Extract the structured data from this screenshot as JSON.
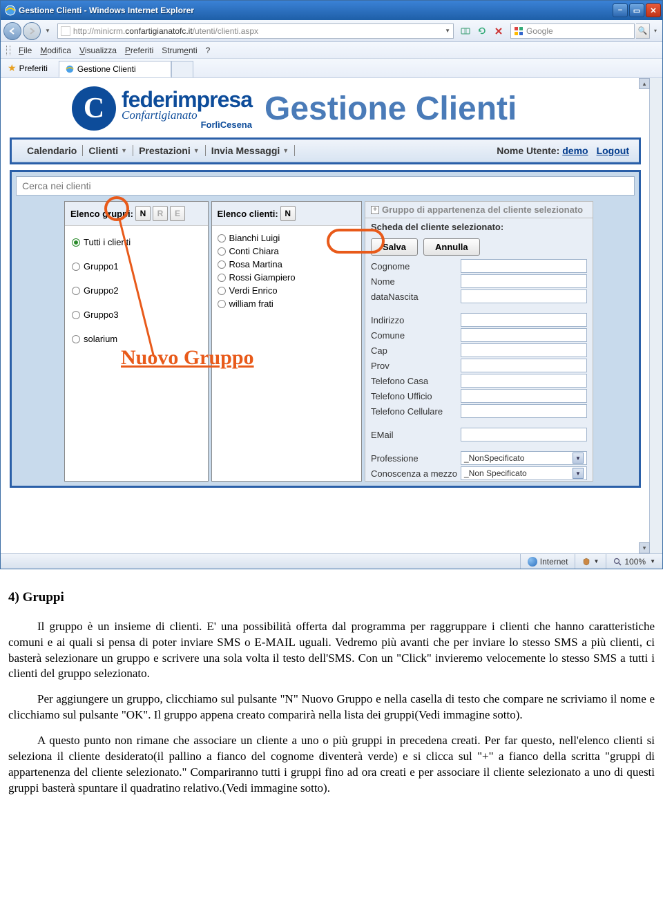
{
  "window": {
    "title": "Gestione Clienti - Windows Internet Explorer",
    "url_gray1": "http://minicrm.",
    "url_dark": "confartigianatofc.it",
    "url_gray2": "/utenti/clienti.aspx",
    "search_placeholder": "Google"
  },
  "menus": {
    "file": "File",
    "mod": "Modifica",
    "vis": "Visualizza",
    "pref": "Preferiti",
    "strum": "Strumenti",
    "q": "?"
  },
  "fav": {
    "label": "Preferiti",
    "tab": "Gestione Clienti"
  },
  "logo": {
    "brand": "federimpresa",
    "sub": "Confartigianato",
    "city": "ForlìCesena",
    "pagetitle": "Gestione Clienti"
  },
  "topmenu": {
    "calendario": "Calendario",
    "clienti": "Clienti",
    "prestazioni": "Prestazioni",
    "invia": "Invia Messaggi",
    "userlabel": "Nome Utente:",
    "username": "demo",
    "logout": "Logout"
  },
  "search": {
    "placeholder": "Cerca nei clienti"
  },
  "groups": {
    "header": "Elenco gruppi:",
    "btn_n": "N",
    "btn_r": "R",
    "btn_e": "E",
    "items": [
      "Tutti i clienti",
      "Gruppo1",
      "Gruppo2",
      "Gruppo3",
      "solarium"
    ]
  },
  "clients": {
    "header": "Elenco clienti:",
    "btn_n": "N",
    "items": [
      "Bianchi Luigi",
      "Conti Chiara",
      "Rosa Martina",
      "Rossi Giampiero",
      "Verdi Enrico",
      "william frati"
    ]
  },
  "detail": {
    "gruppo_header": "Gruppo di appartenenza del cliente selezionato",
    "scheda_header": "Scheda del cliente selezionato:",
    "salva": "Salva",
    "annulla": "Annulla",
    "fields": {
      "cognome": "Cognome",
      "nome": "Nome",
      "datanascita": "dataNascita",
      "indirizzo": "Indirizzo",
      "comune": "Comune",
      "cap": "Cap",
      "prov": "Prov",
      "telcasa": "Telefono Casa",
      "teluff": "Telefono Ufficio",
      "telcell": "Telefono Cellulare",
      "email": "EMail",
      "prof": "Professione",
      "conosc": "Conoscenza a mezzo"
    },
    "select_nonspec": "_NonSpecificato",
    "select_nonspec2": "_Non Specificato"
  },
  "annotation": {
    "text": "Nuovo Gruppo"
  },
  "status": {
    "internet": "Internet",
    "zoom": "100%"
  },
  "doc": {
    "h": "4) Gruppi",
    "p1": "Il gruppo è un insieme di clienti. E' una possibilità offerta dal programma per raggruppare i clienti che hanno caratteristiche comuni e ai quali si pensa di poter inviare SMS o E-MAIL uguali. Vedremo più avanti che per inviare lo stesso SMS a più clienti, ci basterà selezionare un gruppo e scrivere una sola volta il testo dell'SMS. Con un \"Click\" invieremo velocemente lo stesso SMS a tutti i clienti del gruppo selezionato.",
    "p2": "Per aggiungere un gruppo, clicchiamo sul pulsante \"N\" Nuovo Gruppo e nella casella di testo che compare ne scriviamo il nome e clicchiamo sul pulsante \"OK\". Il gruppo appena creato comparirà nella lista dei gruppi(Vedi immagine sotto).",
    "p3": "A questo punto non rimane che associare un cliente a uno o più gruppi in precedena creati. Per far questo, nell'elenco clienti si seleziona il cliente desiderato(il pallino a fianco del cognome diventerà verde) e si clicca sul \"+\" a fianco della scritta \"gruppi di appartenenza del cliente selezionato.\" Compariranno tutti i gruppi fino ad ora creati e per associare il cliente selezionato a uno di questi gruppi basterà spuntare il quadratino relativo.(Vedi immagine sotto)."
  }
}
